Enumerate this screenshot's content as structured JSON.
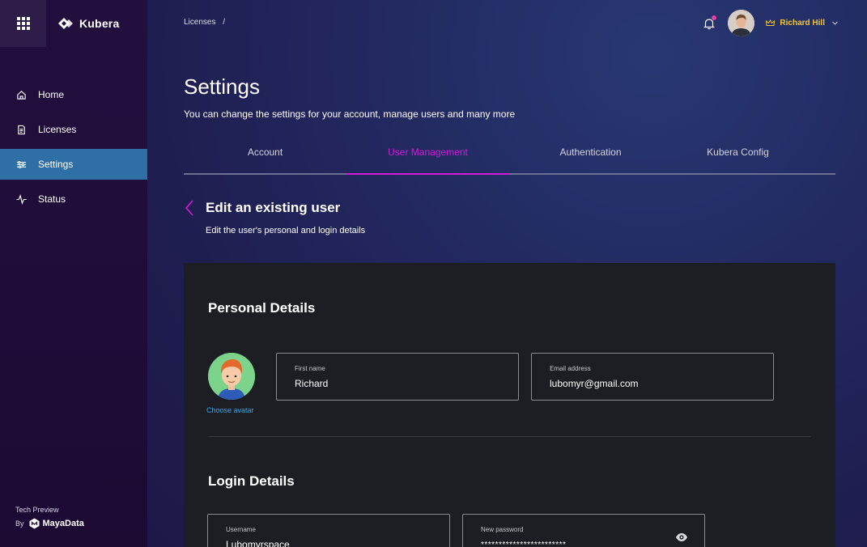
{
  "app": {
    "name": "Kubera"
  },
  "sidebar": {
    "items": [
      {
        "label": "Home",
        "icon": "home-icon"
      },
      {
        "label": "Licenses",
        "icon": "document-icon"
      },
      {
        "label": "Settings",
        "icon": "sliders-icon",
        "active": true
      },
      {
        "label": "Status",
        "icon": "pulse-icon"
      }
    ],
    "footer": {
      "tech_preview": "Tech Preview",
      "by": "By",
      "company": "MayaData"
    }
  },
  "header": {
    "breadcrumb": {
      "item": "Licenses",
      "separator": "/"
    },
    "user_name": "Richard Hill"
  },
  "page": {
    "title": "Settings",
    "subtitle": "You can change the settings for your account, manage users and many more"
  },
  "tabs": [
    {
      "label": "Account"
    },
    {
      "label": "User Management",
      "active": true
    },
    {
      "label": "Authentication"
    },
    {
      "label": "Kubera Config"
    }
  ],
  "edit_user": {
    "title": "Edit an existing user",
    "subtitle": "Edit the user's personal and login details"
  },
  "personal": {
    "title": "Personal Details",
    "choose_avatar": "Choose avatar",
    "first_name_label": "First name",
    "first_name_value": "Richard",
    "email_label": "Email address",
    "email_value": "lubomyr@gmail.com"
  },
  "login": {
    "title": "Login Details",
    "username_label": "Username",
    "username_value": "Lubomyrspace",
    "password_label": "New password",
    "password_value": "************************"
  },
  "colors": {
    "accent": "#d51ad9",
    "sidebar_active": "#2f6fa6",
    "user_name": "#f2c530",
    "link": "#3ba6e2",
    "notification": "#e53fa0"
  }
}
